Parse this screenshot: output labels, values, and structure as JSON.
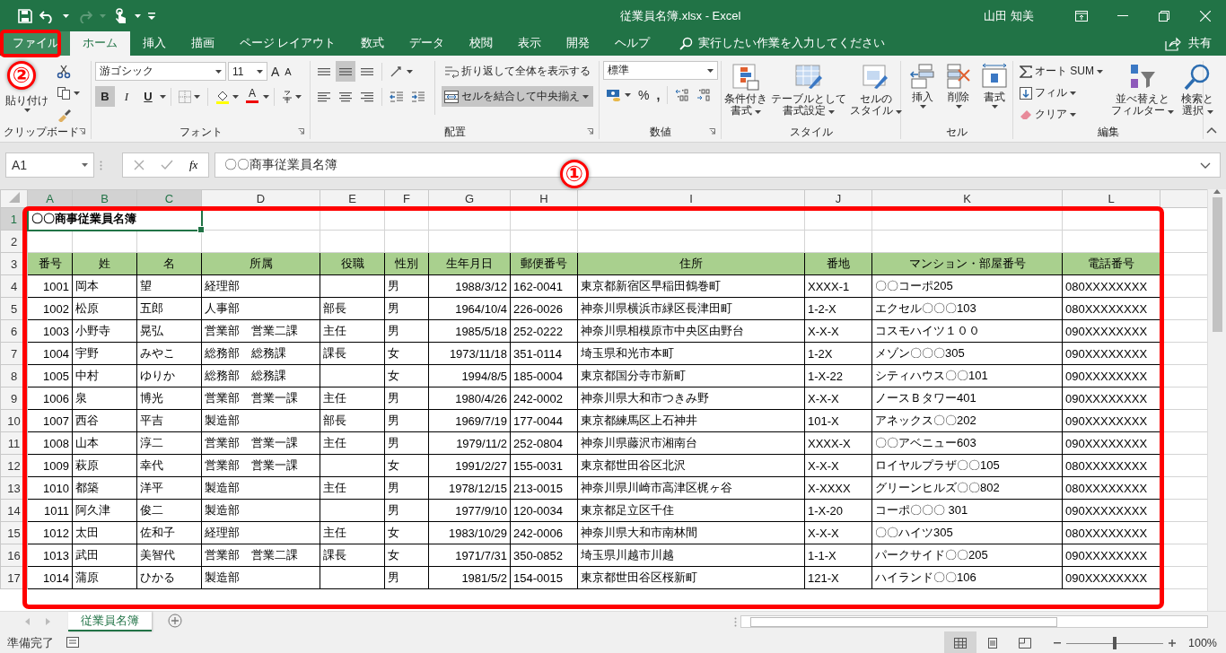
{
  "window": {
    "title": "従業員名簿.xlsx  -  Excel",
    "user": "山田 知美"
  },
  "tabs": [
    {
      "label": "ファイル",
      "kind": "backstage",
      "selected": false
    },
    {
      "label": "ホーム",
      "kind": "tab",
      "selected": true
    },
    {
      "label": "挿入",
      "kind": "tab",
      "selected": false
    },
    {
      "label": "描画",
      "kind": "tab",
      "selected": false
    },
    {
      "label": "ページ レイアウト",
      "kind": "tab",
      "selected": false
    },
    {
      "label": "数式",
      "kind": "tab",
      "selected": false
    },
    {
      "label": "データ",
      "kind": "tab",
      "selected": false
    },
    {
      "label": "校閲",
      "kind": "tab",
      "selected": false
    },
    {
      "label": "表示",
      "kind": "tab",
      "selected": false
    },
    {
      "label": "開発",
      "kind": "tab",
      "selected": false
    },
    {
      "label": "ヘルプ",
      "kind": "tab",
      "selected": false
    }
  ],
  "search": {
    "placeholder": "実行したい作業を入力してください"
  },
  "share": "共有",
  "ribbon": [
    {
      "kind": "clipboard",
      "label": "クリップボード",
      "paste": "貼り付け"
    },
    {
      "kind": "font",
      "label": "フォント",
      "font_name": "游ゴシック",
      "font_size": "11",
      "grow": "A",
      "shrink": "A",
      "font_color": "A",
      "styles": [
        {
          "label": "B",
          "selected": true
        },
        {
          "label": "I",
          "selected": false
        },
        {
          "label": "U",
          "selected": false
        }
      ]
    },
    {
      "kind": "alignment",
      "label": "配置",
      "wrap": "折り返して全体を表示する",
      "merge": "セルを結合して中央揃え",
      "merge_selected": true,
      "vertical": [
        {
          "selected": false
        },
        {
          "selected": true
        },
        {
          "selected": false
        }
      ]
    },
    {
      "kind": "number",
      "label": "数値",
      "format": "標準",
      "percent": "%",
      "comma": ","
    },
    {
      "kind": "styles",
      "label": "スタイル",
      "buttons": [
        [
          "条件付き",
          "書式"
        ],
        [
          "テーブルとして",
          "書式設定"
        ],
        [
          "セルの",
          "スタイル"
        ]
      ]
    },
    {
      "kind": "cells",
      "label": "セル",
      "buttons": [
        "挿入",
        "削除",
        "書式"
      ]
    },
    {
      "kind": "editing",
      "label": "編集",
      "small": [
        "オート SUM",
        "フィル",
        "クリア"
      ],
      "buttons": [
        [
          "並べ替えと",
          "フィルター"
        ],
        [
          "検索と",
          "選択"
        ]
      ]
    }
  ],
  "formula_bar": {
    "name_box": "A1",
    "function_button": "fx",
    "value": "〇〇商事従業員名簿"
  },
  "sheet": {
    "columns": [
      {
        "label": "A",
        "kind": "number",
        "selected": true
      },
      {
        "label": "B",
        "kind": "text",
        "selected": true
      },
      {
        "label": "C",
        "kind": "text",
        "selected": true
      },
      {
        "label": "D",
        "kind": "text",
        "selected": false
      },
      {
        "label": "E",
        "kind": "text",
        "selected": false
      },
      {
        "label": "F",
        "kind": "text",
        "selected": false
      },
      {
        "label": "G",
        "kind": "number",
        "selected": false
      },
      {
        "label": "H",
        "kind": "text",
        "selected": false
      },
      {
        "label": "I",
        "kind": "text",
        "selected": false
      },
      {
        "label": "J",
        "kind": "text",
        "selected": false
      },
      {
        "label": "K",
        "kind": "text",
        "selected": false
      },
      {
        "label": "L",
        "kind": "text",
        "selected": false
      }
    ],
    "rows": [
      {
        "number": "1",
        "kind": "title",
        "selected": true,
        "text": "〇〇商事従業員名簿"
      },
      {
        "number": "2",
        "kind": "blank",
        "selected": false
      },
      {
        "number": "3",
        "kind": "header",
        "selected": false,
        "cells": [
          "番号",
          "姓",
          "名",
          "所属",
          "役職",
          "性別",
          "生年月日",
          "郵便番号",
          "住所",
          "番地",
          "マンション・部屋番号",
          "電話番号"
        ]
      },
      {
        "number": "4",
        "kind": "data",
        "selected": false,
        "cells": [
          "1001",
          "岡本",
          "望",
          "経理部",
          null,
          "男",
          "1988/3/12",
          "162-0041",
          "東京都新宿区早稲田鶴巻町",
          "XXXX-1",
          "〇〇コーポ205",
          "080XXXXXXXX"
        ]
      },
      {
        "number": "5",
        "kind": "data",
        "selected": false,
        "cells": [
          "1002",
          "松原",
          "五郎",
          "人事部",
          "部長",
          "男",
          "1964/10/4",
          "226-0026",
          "神奈川県横浜市緑区長津田町",
          "1-2-X",
          "エクセル〇〇〇103",
          "080XXXXXXXX"
        ]
      },
      {
        "number": "6",
        "kind": "data",
        "selected": false,
        "cells": [
          "1003",
          "小野寺",
          "晃弘",
          "営業部　営業二課",
          "主任",
          "男",
          "1985/5/18",
          "252-0222",
          "神奈川県相模原市中央区由野台",
          "X-X-X",
          "コスモハイツ１００",
          "090XXXXXXXX"
        ]
      },
      {
        "number": "7",
        "kind": "data",
        "selected": false,
        "cells": [
          "1004",
          "宇野",
          "みやこ",
          "総務部　総務課",
          "課長",
          "女",
          "1973/11/18",
          "351-0114",
          "埼玉県和光市本町",
          "1-2X",
          "メゾン〇〇〇305",
          "090XXXXXXXX"
        ]
      },
      {
        "number": "8",
        "kind": "data",
        "selected": false,
        "cells": [
          "1005",
          "中村",
          "ゆりか",
          "総務部　総務課",
          null,
          "女",
          "1994/8/5",
          "185-0004",
          "東京都国分寺市新町",
          "1-X-22",
          "シティハウス〇〇101",
          "090XXXXXXXX"
        ]
      },
      {
        "number": "9",
        "kind": "data",
        "selected": false,
        "cells": [
          "1006",
          "泉",
          "博光",
          "営業部　営業一課",
          "主任",
          "男",
          "1980/4/26",
          "242-0002",
          "神奈川県大和市つきみ野",
          "X-X-X",
          "ノースＢタワー401",
          "090XXXXXXXX"
        ]
      },
      {
        "number": "10",
        "kind": "data",
        "selected": false,
        "cells": [
          "1007",
          "西谷",
          "平吉",
          "製造部",
          "部長",
          "男",
          "1969/7/19",
          "177-0044",
          "東京都練馬区上石神井",
          "101-X",
          "アネックス〇〇202",
          "090XXXXXXXX"
        ]
      },
      {
        "number": "11",
        "kind": "data",
        "selected": false,
        "cells": [
          "1008",
          "山本",
          "淳二",
          "営業部　営業一課",
          "主任",
          "男",
          "1979/11/2",
          "252-0804",
          "神奈川県藤沢市湘南台",
          "XXXX-X",
          "〇〇アベニュー603",
          "090XXXXXXXX"
        ]
      },
      {
        "number": "12",
        "kind": "data",
        "selected": false,
        "cells": [
          "1009",
          "萩原",
          "幸代",
          "営業部　営業一課",
          null,
          "女",
          "1991/2/27",
          "155-0031",
          "東京都世田谷区北沢",
          "X-X-X",
          "ロイヤルプラザ〇〇105",
          "080XXXXXXXX"
        ]
      },
      {
        "number": "13",
        "kind": "data",
        "selected": false,
        "cells": [
          "1010",
          "都築",
          "洋平",
          "製造部",
          "主任",
          "男",
          "1978/12/15",
          "213-0015",
          "神奈川県川崎市高津区梶ヶ谷",
          "X-XXXX",
          "グリーンヒルズ〇〇802",
          "080XXXXXXXX"
        ]
      },
      {
        "number": "14",
        "kind": "data",
        "selected": false,
        "cells": [
          "1011",
          "阿久津",
          "俊二",
          "製造部",
          null,
          "男",
          "1977/9/10",
          "120-0034",
          "東京都足立区千住",
          "1-X-20",
          "コーポ〇〇〇 301",
          "090XXXXXXXX"
        ]
      },
      {
        "number": "15",
        "kind": "data",
        "selected": false,
        "cells": [
          "1012",
          "太田",
          "佐和子",
          "経理部",
          "主任",
          "女",
          "1983/10/29",
          "242-0006",
          "神奈川県大和市南林間",
          "X-X-X",
          "〇〇ハイツ305",
          "080XXXXXXXX"
        ]
      },
      {
        "number": "16",
        "kind": "data",
        "selected": false,
        "cells": [
          "1013",
          "武田",
          "美智代",
          "営業部　営業二課",
          "課長",
          "女",
          "1971/7/31",
          "350-0852",
          "埼玉県川越市川越",
          "1-1-X",
          "パークサイド〇〇205",
          "090XXXXXXXX"
        ]
      },
      {
        "number": "17",
        "kind": "data",
        "selected": false,
        "cells": [
          "1014",
          "蒲原",
          "ひかる",
          "製造部",
          null,
          "男",
          "1981/5/2",
          "154-0015",
          "東京都世田谷区桜新町",
          "121-X",
          "ハイランド〇〇106",
          "090XXXXXXXX"
        ]
      }
    ]
  },
  "callouts": [
    {
      "label": "①"
    },
    {
      "label": "②"
    }
  ],
  "sheet_tabs": [
    {
      "label": "従業員名簿",
      "selected": true
    }
  ],
  "status_bar": {
    "text": "準備完了",
    "views": [
      {
        "selected": true
      },
      {
        "selected": false
      },
      {
        "selected": false
      }
    ],
    "zoom": {
      "level": 0.5,
      "reading": "100%"
    }
  }
}
